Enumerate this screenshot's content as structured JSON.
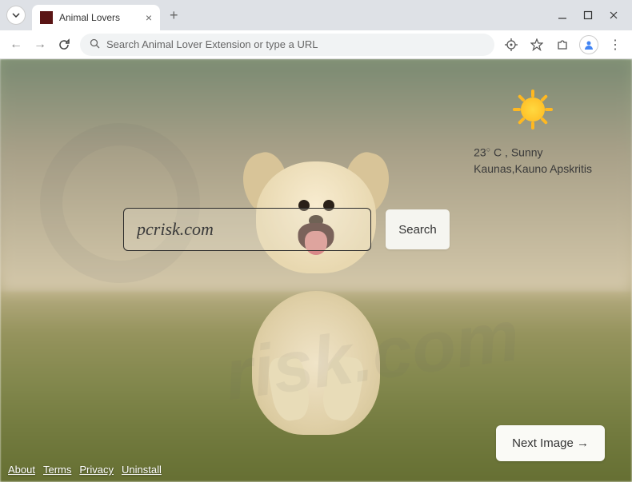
{
  "browser": {
    "tab_title": "Animal Lovers",
    "address_placeholder": "Search Animal Lover Extension or type a URL"
  },
  "weather": {
    "temp_value": "23",
    "temp_unit": "C",
    "condition": "Sunny",
    "location": "Kaunas,Kauno Apskritis"
  },
  "search": {
    "value": "pcrisk.com",
    "button_label": "Search"
  },
  "next_image": {
    "label": "Next Image →"
  },
  "footer": {
    "about": "About",
    "terms": "Terms",
    "privacy": "Privacy",
    "uninstall": "Uninstall"
  }
}
